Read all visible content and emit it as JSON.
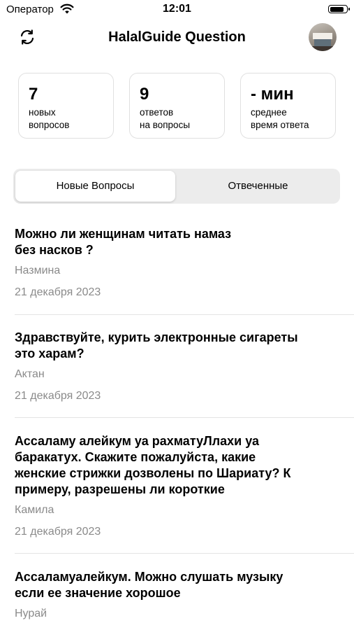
{
  "status_bar": {
    "carrier": "Оператор",
    "time": "12:01",
    "battery_level": 0.9
  },
  "header": {
    "title": "HalalGuide Question",
    "refresh_icon": "refresh-icon",
    "avatar_icon": "avatar"
  },
  "stats": [
    {
      "value": "7",
      "label": "новых\nвопросов"
    },
    {
      "value": "9",
      "label": "ответов\nна вопросы"
    },
    {
      "value": "- мин",
      "label": "среднее\nвремя ответа"
    }
  ],
  "tabs": [
    {
      "label": "Новые Вопросы",
      "active": true
    },
    {
      "label": "Отвеченные",
      "active": false
    }
  ],
  "questions": [
    {
      "title": "Можно ли женщинам читать намаз\nбез насков ?",
      "author": "Назмина",
      "date": "21 декабря 2023"
    },
    {
      "title": "Здравствуйте, курить электронные сигареты\nэто харам?",
      "author": "Актан",
      "date": "21 декабря 2023"
    },
    {
      "title": "Ассаламу алейкум уа рахматуЛлахи уа\nбаракатух. Скажите пожалуйста, какие\nженские стрижки дозволены по Шариату? К\nпримеру, разрешены ли короткие",
      "author": "Камила",
      "date": "21 декабря 2023"
    },
    {
      "title": "Ассаламуалейкум. Можно слушать музыку\nесли ее значение хорошое",
      "author": "Нурай",
      "date": ""
    }
  ]
}
